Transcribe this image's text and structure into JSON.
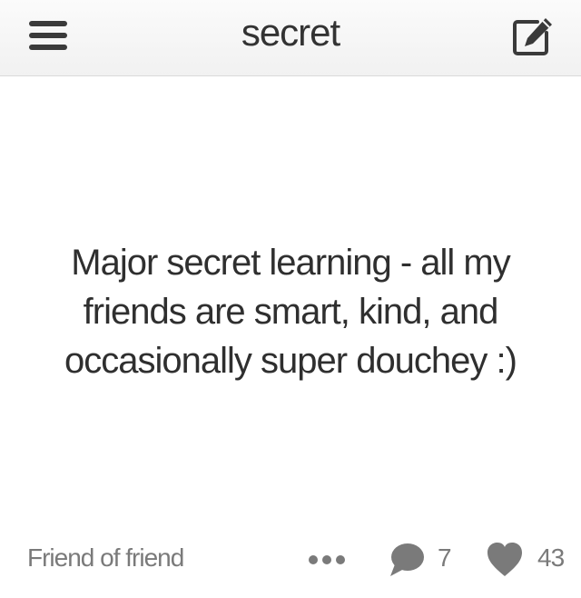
{
  "header": {
    "title": "secret",
    "menu_icon": "hamburger-menu-icon",
    "compose_icon": "compose-edit-icon"
  },
  "post": {
    "text": "Major secret learning - all my friends are smart, kind, and occasionally super douchey :)",
    "source": "Friend of friend",
    "comment_count": "7",
    "like_count": "43"
  },
  "colors": {
    "text_dark": "#2f2f2f",
    "text_muted": "#7a7a7a",
    "header_bg": "#f4f4f4",
    "icon": "#3a3a3a"
  }
}
